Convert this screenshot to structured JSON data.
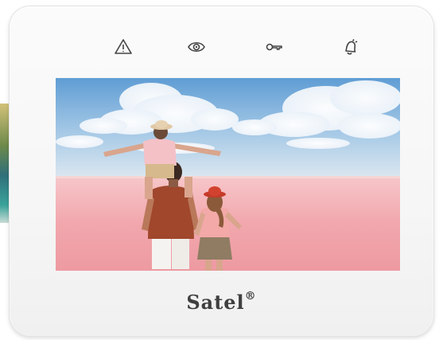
{
  "device": {
    "brand": "Satel",
    "brand_mark": "®"
  },
  "indicators": [
    {
      "name": "alarm",
      "icon": "warning-triangle-icon"
    },
    {
      "name": "armed",
      "icon": "eye-icon"
    },
    {
      "name": "service",
      "icon": "key-icon"
    },
    {
      "name": "trouble",
      "icon": "bell-icon"
    }
  ],
  "screen": {
    "content": "photo",
    "colors": {
      "sky_top": "#6ea6d8",
      "sky_bottom": "#cfe1ef",
      "water": "#f1aab0",
      "accent_led": "#444444"
    }
  }
}
